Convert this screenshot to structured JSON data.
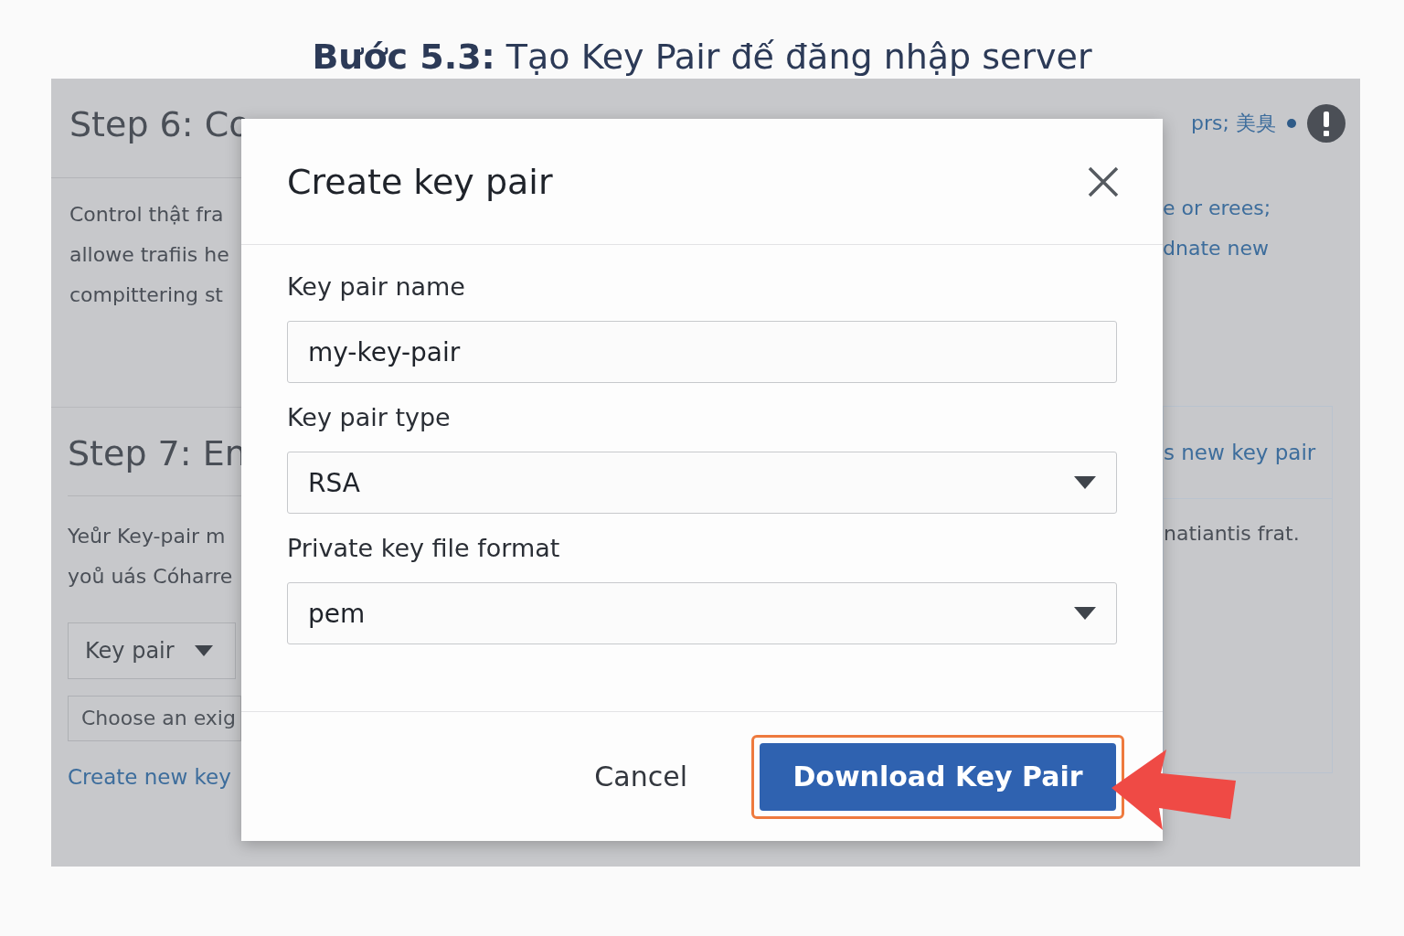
{
  "tutorial_title": "**Bước 5.3:** Tạo Key Pair đế đăng nhập server",
  "background": {
    "left": {
      "step6_heading": "Step 6: Co",
      "step6_lines": [
        "Control thật fra",
        "allowe trafiis he",
        "compittering st"
      ],
      "step7_heading": "Step 7: En",
      "step7_lines": [
        "Yeůr Key-pair m",
        "yoů uás Cóharre"
      ],
      "key_pair_dropdown": "Key pair",
      "existing_field": "Choose an exig",
      "create_link": "Create new key"
    },
    "right": {
      "top_link": "prs; 美臭",
      "lines": [
        "e or erees;",
        "dnate new"
      ],
      "panel_link": "s new key pair",
      "panel_text": "natiantis frat."
    }
  },
  "modal": {
    "title": "Create key pair",
    "fields": [
      {
        "kind": "input",
        "label": "Key pair name",
        "value": "my-key-pair"
      },
      {
        "kind": "select",
        "label": "Key pair type",
        "value": "RSA"
      },
      {
        "kind": "select",
        "label": "Private key file format",
        "value": "pem"
      }
    ],
    "cancel": "Cancel",
    "primary": {
      "label": "Download Key Pair",
      "highlighted": true
    }
  }
}
